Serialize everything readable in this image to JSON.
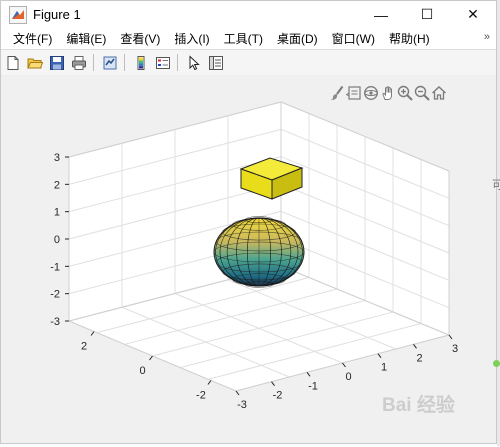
{
  "window": {
    "title": "Figure 1",
    "minimize_symbol": "—",
    "maximize_symbol": "☐",
    "close_symbol": "✕"
  },
  "menubar": {
    "items": [
      "文件(F)",
      "编辑(E)",
      "查看(V)",
      "插入(I)",
      "工具(T)",
      "桌面(D)",
      "窗口(W)",
      "帮助(H)"
    ],
    "overflow_symbol": "»"
  },
  "toolbar": {
    "icons": [
      "new-figure-icon",
      "open-file-icon",
      "save-icon",
      "print-icon",
      "link-plot-icon",
      "insert-colorbar-icon",
      "insert-legend-icon",
      "pointer-icon",
      "property-editor-icon"
    ]
  },
  "axes_toolbar": {
    "icons": [
      "brush-icon",
      "data-tips-icon",
      "rotate-3d-icon",
      "pan-icon",
      "zoom-in-icon",
      "zoom-out-icon",
      "home-icon"
    ]
  },
  "plot": {
    "z_ticks": [
      "3",
      "2",
      "1",
      "0",
      "-1",
      "-2",
      "-3"
    ],
    "x_ticks": [
      "-3",
      "-2",
      "-1",
      "0",
      "1",
      "2",
      "3"
    ],
    "y_ticks": [
      "2",
      "0",
      "-2"
    ],
    "colors": {
      "cube_face_top": "#f4ea3a",
      "cube_face_front": "#e9dc1a",
      "cube_face_side": "#c9bd12",
      "grid": "#e0e0e0",
      "box": "#d0d0d0",
      "plot_bg": "#ffffff"
    }
  },
  "background": {
    "watermark_text": "Bai 经验",
    "edge_char": "可"
  }
}
